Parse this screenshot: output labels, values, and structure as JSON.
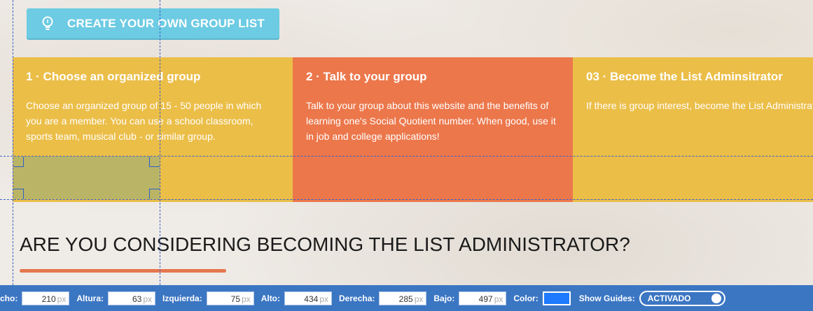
{
  "cta": {
    "label": "CREATE YOUR OWN GROUP LIST",
    "icon": "lightbulb-icon"
  },
  "steps": [
    {
      "title": "1 · Choose an organized group",
      "text": "Choose an organized group of 15 - 50 people in which you are a member. You can use a school classroom, sports team, musical club - or similar group.",
      "color": "#ebbe48"
    },
    {
      "title": "2 · Talk to your group",
      "text": "Talk to your group about this website and the benefits of learning one's Social Quotient number. When good, use it in job and college applications!",
      "color": "#ec774b"
    },
    {
      "title": "03 · Become the List Adminsitrator",
      "text": "If there is group interest, become the List Administrator (getting names and emails for the quiz). Others in your group can help you.",
      "color": "#ebbe48"
    }
  ],
  "section": {
    "heading": "ARE YOU CONSIDERING BECOMING THE LIST ADMINISTRATOR?"
  },
  "toolbar": {
    "ancho_label": "cho:",
    "ancho_value": "210",
    "altura_label": "Altura:",
    "altura_value": "63",
    "izquierda_label": "Izquierda:",
    "izquierda_value": "75",
    "alto_label": "Alto:",
    "alto_value": "434",
    "derecha_label": "Derecha:",
    "derecha_value": "285",
    "bajo_label": "Bajo:",
    "bajo_value": "497",
    "unit": "px",
    "color_label": "Color:",
    "color_value": "#1e7bff",
    "guides_label": "Show Guides:",
    "guides_state": "ACTIVADO"
  }
}
